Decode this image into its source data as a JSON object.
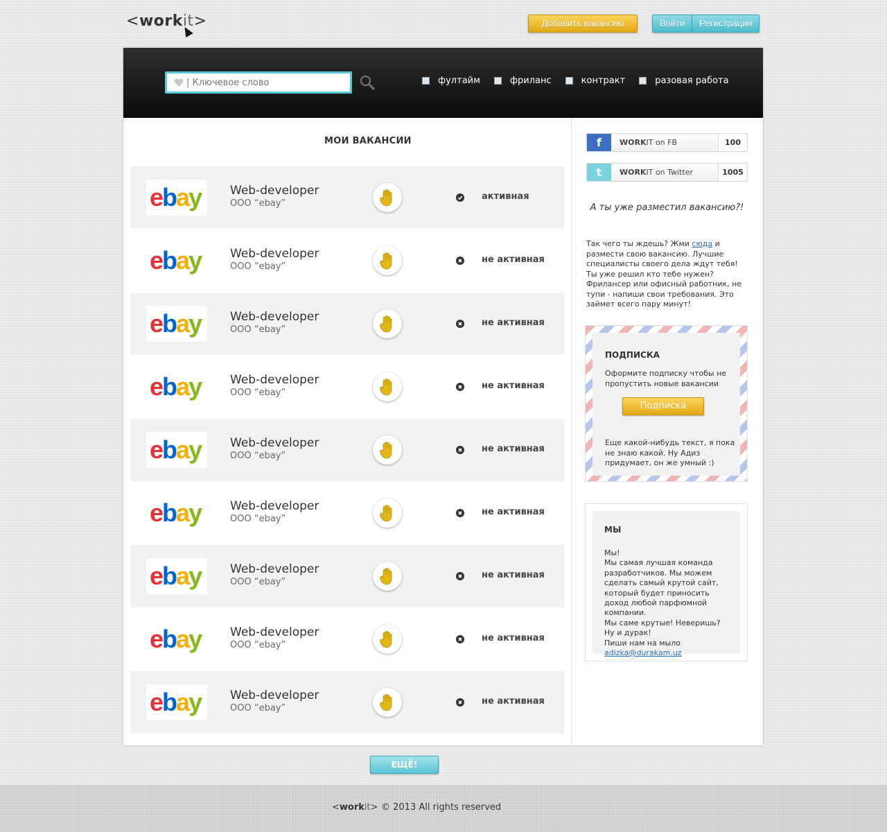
{
  "header": {
    "logo": {
      "open": "<",
      "bold": "work",
      "light": "it",
      "close": ">"
    },
    "add_vacancy_label": "Добавить вакансию",
    "login_label": "Войти",
    "register_label": "Регистрация"
  },
  "search": {
    "placeholder": "| Ключевое слово",
    "filters": [
      {
        "label": "фултайм",
        "checked": false
      },
      {
        "label": "фриланс",
        "checked": false
      },
      {
        "label": "контракт",
        "checked": false
      },
      {
        "label": "разовая работа",
        "checked": false
      }
    ]
  },
  "main": {
    "title": "МОИ ВАКАНСИИ",
    "vacancies": [
      {
        "title": "Web-developer",
        "company": "ООО “ebay”",
        "status": "активная",
        "active": true
      },
      {
        "title": "Web-developer",
        "company": "ООО “ebay”",
        "status": "не активная",
        "active": false
      },
      {
        "title": "Web-developer",
        "company": "ООО “ebay”",
        "status": "не активная",
        "active": false
      },
      {
        "title": "Web-developer",
        "company": "ООО “ebay”",
        "status": "не активная",
        "active": false
      },
      {
        "title": "Web-developer",
        "company": "ООО “ebay”",
        "status": "не активная",
        "active": false
      },
      {
        "title": "Web-developer",
        "company": "ООО “ebay”",
        "status": "не активная",
        "active": false
      },
      {
        "title": "Web-developer",
        "company": "ООО “ebay”",
        "status": "не активная",
        "active": false
      },
      {
        "title": "Web-developer",
        "company": "ООО “ebay”",
        "status": "не активная",
        "active": false
      },
      {
        "title": "Web-developer",
        "company": "ООО “ebay”",
        "status": "не активная",
        "active": false
      }
    ],
    "more_label": "ЕЩЁ!"
  },
  "sidebar": {
    "social": [
      {
        "icon": "facebook-icon",
        "glyph": "f",
        "brand": "WORK",
        "suffix": "IT on FB",
        "count": "100"
      },
      {
        "icon": "twitter-icon",
        "glyph": "t",
        "brand": "WORK",
        "suffix": "IT on Twitter",
        "count": "1005"
      }
    ],
    "promo": {
      "heading": "А ты уже разместил вакансию?!",
      "text_before": "Так чего ты ждешь? Жми ",
      "link": "сюда",
      "text_after": " и размести свою вакансию. Лучшие специалисты своего дела ждут тебя! Ты уже решил кто тебе нужен? Фрилансер или офисный работник, не тупи - напиши свои требования. Это займет всего пару минут!"
    },
    "subscription": {
      "title": "ПОДПИСКА",
      "text": "Оформите подписку чтобы не пропустить новые вакансии",
      "button": "Подписка",
      "text2": "Еще какой-нибудь текст, я пока не знаю какой.  Ну Адиз придумает, он же умный :)"
    },
    "us": {
      "title": "МЫ",
      "lines": [
        "Мы!",
        "Мы самая лучшая команда разработчиков. Мы можем сделать самый крутой сайт, который будет приносить доход любой парфюмной компании.",
        "Мы саме крутые! Неверишь?",
        "Ну и дурак!",
        "Пиши нам на мыло"
      ],
      "email": "adizka@durakam.uz"
    }
  },
  "footer": {
    "logo": {
      "open": "<",
      "bold": "work",
      "light": "it",
      "close": ">"
    },
    "copyright": "© 2013 All rights reserved"
  },
  "colors": {
    "accent_yellow": "#f1bf2e",
    "accent_cyan": "#58c9d9",
    "dark_bar": "#1a1a1a",
    "ebay_red": "#e53238",
    "ebay_blue": "#0064d2",
    "ebay_yellow": "#f5af02",
    "ebay_green": "#86b817"
  }
}
